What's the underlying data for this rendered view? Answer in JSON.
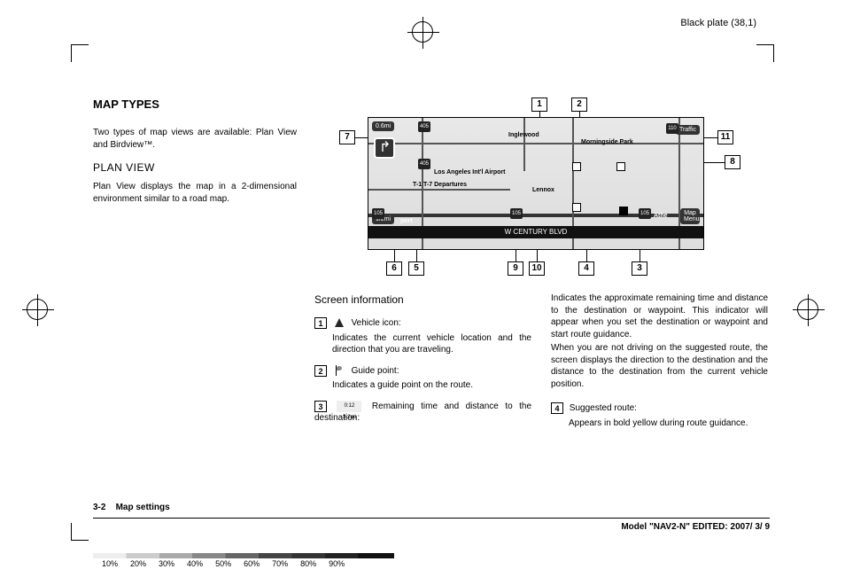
{
  "header": {
    "plate": "Black plate (38,1)"
  },
  "section": {
    "title": "MAP TYPES",
    "intro": "Two types of map views are available: Plan View and Birdview™.",
    "plan_view_title": "PLAN VIEW",
    "plan_view_desc": "Plan View displays the map in a 2-dimensional environment similar to a road map."
  },
  "map": {
    "callouts": [
      "1",
      "2",
      "3",
      "4",
      "5",
      "6",
      "7",
      "8",
      "9",
      "10",
      "11"
    ],
    "distance_badge": "0.6mi",
    "remain_badge": "0:12, 3.2mi",
    "banner": "W CENTURY BLVD",
    "places": {
      "inglewood": "Inglewood",
      "morningside": "Morningside Park",
      "traffic": "Traffic",
      "lax": "Los Angeles Int'l Airport",
      "dept": "T-1 T-7 Departures",
      "lennox": "Lennox",
      "athe": "Athe",
      "mapmenu": "Map Menu",
      "scale": "1/2mi",
      "port": "port"
    },
    "shields": {
      "r405a": "405",
      "r405b": "405",
      "r110": "110",
      "r105a": "105",
      "r105b": "105",
      "r105c": "105"
    }
  },
  "screen_info": {
    "title": "Screen information",
    "items": {
      "i1": {
        "num": "1",
        "label": "Vehicle icon:",
        "desc": "Indicates the current vehicle location and the direction that you are traveling."
      },
      "i2": {
        "num": "2",
        "label": "Guide point:",
        "desc": "Indicates a guide point on the route."
      },
      "i3": {
        "num": "3",
        "icon_text": "0:12 3.2mi",
        "label": "Remaining time and distance to the destination:",
        "desc": "Indicates the approximate remaining time and distance to the destination or waypoint. This indicator will appear when you set the destination or waypoint and start route guidance.",
        "desc2": "When you are not driving on the suggested route, the screen displays the direction to the destination and the distance to the destination from the current vehicle position."
      },
      "i4": {
        "num": "4",
        "label": "Suggested route:",
        "desc": "Appears in bold yellow during route guidance."
      }
    }
  },
  "footer": {
    "page": "3-2",
    "page_title": "Map settings",
    "model": "Model \"NAV2-N\" EDITED: 2007/ 3/ 9"
  },
  "percents": [
    "10%",
    "20%",
    "30%",
    "40%",
    "50%",
    "60%",
    "70%",
    "80%",
    "90%"
  ]
}
